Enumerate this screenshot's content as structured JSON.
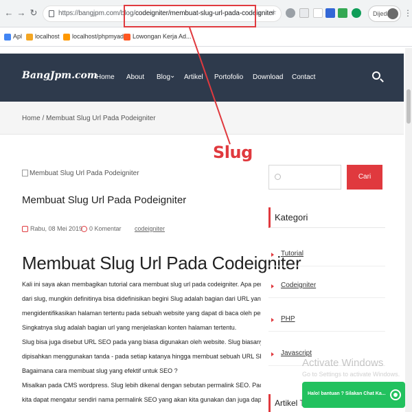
{
  "browser": {
    "url_prefix": "https://bangjpm.com/blog/",
    "url_slug": "codeigniter/membuat-slug-url-pada-codeigniter",
    "profile_label": "Dijeda",
    "bookmarks": [
      "Apl",
      "localhost",
      "localhost/phpmyad...",
      "Lowongan Kerja Ad..."
    ]
  },
  "site": {
    "logo": "BangJpm.com",
    "nav": [
      "Home",
      "About",
      "Blog",
      "Artikel",
      "Portofolio",
      "Download",
      "Contact"
    ],
    "blog_caret": "⌄"
  },
  "breadcrumb": {
    "home": "Home",
    "separator": "/",
    "current": "Membuat Slug Url Pada Podeigniter"
  },
  "annotation": {
    "label": "Slug",
    "color": "#e0393e"
  },
  "article": {
    "image_alt": "Membuat Slug Url Pada Podeigniter",
    "title": "Membuat Slug Url Pada Podeigniter",
    "date": "Rabu, 08 Mei 2019",
    "comments": "0 Komentar",
    "category": "codeigniter",
    "heading": "Membuat Slug Url Pada Codeigniter",
    "paragraphs": [
      "Kali ini saya akan membagikan tutorial cara membuat slug url pada codeigniter. Apa pengertian",
      "dari slug, mungkin definitinya bisa didefinisikan begini Slug adalah bagian dari URL yang",
      "mengidentifikasikan halaman tertentu pada sebuah website yang dapat di baca oleh pengguna.",
      "Singkatnya slug adalah bagian url yang menjelaskan  konten halaman tertentu.",
      "Slug bisa juga disebut URL SEO pada yang biasa digunakan oleh website. Slug biasanya",
      "dipisahkan menggunakan tanda - pada setiap katanya hingga membuat sebuah URL SEO.",
      "Bagaimana cara membuat slug yang efektif untuk SEO ?",
      "Misalkan pada CMS wordpress. Slug lebih dikenal dengan sebutan permalink SEO. Pada wordpress",
      "kita dapat mengatur sendiri nama permalink SEO yang akan kita gunakan dan juga dapat"
    ]
  },
  "sidebar": {
    "search_button": "Cari",
    "widget_title": "Kategori",
    "categories": [
      "Tutorial",
      "Codeigniter",
      "PHP",
      "Javascript"
    ],
    "widget2_title": "Artikel Terbaru"
  },
  "overlay": {
    "watermark_title": "Activate Windows",
    "watermark_sub": "Go to Settings to activate Windows.",
    "whatsapp_text": "Halo! bantuan ? Silakan Chat Ka..."
  }
}
